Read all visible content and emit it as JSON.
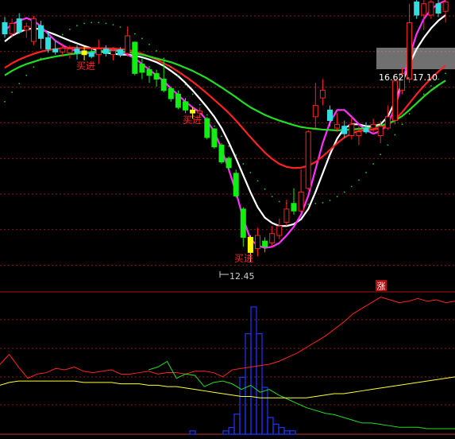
{
  "chart_data": [
    {
      "type": "candlestick",
      "panel": "price",
      "y_axis": "price (unlabeled)",
      "ylim": [
        11.8,
        19.4
      ],
      "candles": [
        {
          "o": 18.8,
          "c": 18.5,
          "h": 18.95,
          "l": 18.4,
          "col": "cyan"
        },
        {
          "o": 18.5,
          "c": 18.78,
          "h": 18.9,
          "l": 18.4,
          "col": "red"
        },
        {
          "o": 18.9,
          "c": 18.55,
          "h": 19.05,
          "l": 18.5,
          "col": "cyan"
        },
        {
          "o": 18.6,
          "c": 18.7,
          "h": 18.8,
          "l": 18.4,
          "col": "red"
        },
        {
          "o": 18.3,
          "c": 18.9,
          "h": 18.98,
          "l": 18.2,
          "col": "red"
        },
        {
          "o": 18.72,
          "c": 18.38,
          "h": 18.85,
          "l": 18.1,
          "col": "cyan"
        },
        {
          "o": 18.4,
          "c": 18.1,
          "h": 18.55,
          "l": 18.0,
          "col": "cyan"
        },
        {
          "o": 18.1,
          "c": 18.02,
          "h": 18.3,
          "l": 17.95,
          "col": "cyan"
        },
        {
          "o": 18.02,
          "c": 18.12,
          "h": 18.25,
          "l": 17.9,
          "col": "red"
        },
        {
          "o": 18.0,
          "c": 18.1,
          "h": 18.2,
          "l": 17.85,
          "col": "red"
        },
        {
          "o": 18.1,
          "c": 18.0,
          "h": 18.2,
          "l": 17.82,
          "col": "cyan"
        },
        {
          "o": 18.05,
          "c": 17.95,
          "h": 18.15,
          "l": 17.8,
          "col": "yellow"
        },
        {
          "o": 18.0,
          "c": 17.9,
          "h": 18.1,
          "l": 17.85,
          "col": "cyan"
        },
        {
          "o": 17.95,
          "c": 18.1,
          "h": 18.35,
          "l": 17.7,
          "col": "red"
        },
        {
          "o": 18.1,
          "c": 17.98,
          "h": 18.2,
          "l": 17.9,
          "col": "cyan"
        },
        {
          "o": 17.95,
          "c": 18.05,
          "h": 18.15,
          "l": 17.8,
          "col": "red"
        },
        {
          "o": 18.08,
          "c": 17.95,
          "h": 18.15,
          "l": 17.88,
          "col": "cyan"
        },
        {
          "o": 17.98,
          "c": 18.45,
          "h": 18.7,
          "l": 17.9,
          "col": "red"
        },
        {
          "o": 18.28,
          "c": 17.45,
          "h": 18.3,
          "l": 17.4,
          "col": "green"
        },
        {
          "o": 17.7,
          "c": 17.48,
          "h": 17.85,
          "l": 17.3,
          "col": "green"
        },
        {
          "o": 17.55,
          "c": 17.4,
          "h": 17.65,
          "l": 17.2,
          "col": "green"
        },
        {
          "o": 17.45,
          "c": 17.3,
          "h": 17.55,
          "l": 17.1,
          "col": "green"
        },
        {
          "o": 17.3,
          "c": 17.0,
          "h": 17.8,
          "l": 16.95,
          "col": "green"
        },
        {
          "o": 17.05,
          "c": 16.78,
          "h": 17.1,
          "l": 16.7,
          "col": "green"
        },
        {
          "o": 16.9,
          "c": 16.55,
          "h": 17.0,
          "l": 16.5,
          "col": "green"
        },
        {
          "o": 16.7,
          "c": 16.48,
          "h": 16.8,
          "l": 16.4,
          "col": "green"
        },
        {
          "o": 16.48,
          "c": 16.4,
          "h": 16.55,
          "l": 16.25,
          "col": "yellow"
        },
        {
          "o": 16.45,
          "c": 16.4,
          "h": 16.55,
          "l": 16.3,
          "col": "red"
        },
        {
          "o": 16.25,
          "c": 15.75,
          "h": 16.3,
          "l": 15.7,
          "col": "green"
        },
        {
          "o": 15.98,
          "c": 15.5,
          "h": 16.0,
          "l": 15.45,
          "col": "green"
        },
        {
          "o": 15.55,
          "c": 15.1,
          "h": 15.6,
          "l": 15.05,
          "col": "green"
        },
        {
          "o": 15.2,
          "c": 14.95,
          "h": 15.25,
          "l": 14.9,
          "col": "green"
        },
        {
          "o": 14.8,
          "c": 14.2,
          "h": 14.9,
          "l": 14.15,
          "col": "green"
        },
        {
          "o": 13.85,
          "c": 13.1,
          "h": 13.9,
          "l": 12.85,
          "col": "green"
        },
        {
          "o": 13.1,
          "c": 12.7,
          "h": 13.15,
          "l": 12.45,
          "col": "yellow"
        },
        {
          "o": 12.8,
          "c": 13.15,
          "h": 13.35,
          "l": 12.6,
          "col": "red"
        },
        {
          "o": 13.0,
          "c": 12.85,
          "h": 13.1,
          "l": 12.7,
          "col": "green"
        },
        {
          "o": 12.95,
          "c": 13.2,
          "h": 13.4,
          "l": 12.85,
          "col": "red"
        },
        {
          "o": 13.15,
          "c": 13.4,
          "h": 13.6,
          "l": 13.05,
          "col": "red"
        },
        {
          "o": 13.5,
          "c": 13.85,
          "h": 14.1,
          "l": 13.4,
          "col": "red"
        },
        {
          "o": 13.8,
          "c": 14.0,
          "h": 14.4,
          "l": 13.7,
          "col": "green"
        },
        {
          "o": 13.8,
          "c": 14.3,
          "h": 14.9,
          "l": 13.75,
          "col": "red"
        },
        {
          "o": 14.4,
          "c": 15.9,
          "h": 15.95,
          "l": 14.35,
          "col": "red"
        },
        {
          "o": 16.3,
          "c": 16.6,
          "h": 17.2,
          "l": 16.0,
          "col": "red"
        },
        {
          "o": 16.8,
          "c": 17.0,
          "h": 17.3,
          "l": 16.6,
          "col": "red"
        },
        {
          "o": 16.48,
          "c": 16.2,
          "h": 16.6,
          "l": 16.05,
          "col": "cyan"
        },
        {
          "o": 16.1,
          "c": 16.0,
          "h": 16.4,
          "l": 15.9,
          "col": "red"
        },
        {
          "o": 16.05,
          "c": 15.85,
          "h": 16.2,
          "l": 15.75,
          "col": "cyan"
        },
        {
          "o": 15.8,
          "c": 16.1,
          "h": 16.3,
          "l": 15.7,
          "col": "red"
        },
        {
          "o": 15.9,
          "c": 15.8,
          "h": 16.05,
          "l": 15.55,
          "col": "red"
        },
        {
          "o": 16.0,
          "c": 15.9,
          "h": 16.15,
          "l": 15.85,
          "col": "cyan"
        },
        {
          "o": 16.0,
          "c": 16.1,
          "h": 16.25,
          "l": 15.85,
          "col": "red"
        },
        {
          "o": 15.8,
          "c": 16.05,
          "h": 16.2,
          "l": 15.6,
          "col": "red"
        },
        {
          "o": 16.0,
          "c": 16.3,
          "h": 16.6,
          "l": 15.95,
          "col": "red"
        },
        {
          "o": 16.2,
          "c": 17.25,
          "h": 17.3,
          "l": 16.1,
          "col": "red"
        },
        {
          "o": 17.0,
          "c": 17.45,
          "h": 17.6,
          "l": 16.9,
          "col": "red"
        },
        {
          "o": 17.3,
          "c": 18.8,
          "h": 19.3,
          "l": 17.2,
          "col": "red"
        },
        {
          "o": 19.35,
          "c": 19.0,
          "h": 19.4,
          "l": 18.9,
          "col": "cyan"
        },
        {
          "o": 19.0,
          "c": 19.3,
          "h": 19.4,
          "l": 18.6,
          "col": "red"
        },
        {
          "o": 19.0,
          "c": 19.35,
          "h": 19.4,
          "l": 18.9,
          "col": "red"
        },
        {
          "o": 19.3,
          "c": 19.05,
          "h": 19.4,
          "l": 18.95,
          "col": "cyan"
        },
        {
          "o": 19.1,
          "c": 19.35,
          "h": 19.4,
          "l": 18.8,
          "col": "red"
        }
      ],
      "series": [
        {
          "name": "",
          "color": "#ffffff",
          "values": [
            18.3,
            18.45,
            18.55,
            18.62,
            18.65,
            18.62,
            18.55,
            18.48,
            18.4,
            18.32,
            18.25,
            18.18,
            18.12,
            18.05,
            18.0,
            17.98,
            17.95,
            17.95,
            17.92,
            17.88,
            17.82,
            17.75,
            17.65,
            17.52,
            17.38,
            17.2,
            17.0,
            16.78,
            16.55,
            16.3,
            16.0,
            15.62,
            15.2,
            14.75,
            14.3,
            13.9,
            13.62,
            13.48,
            13.4,
            13.4,
            13.45,
            13.58,
            13.85,
            14.3,
            14.8,
            15.3,
            15.72,
            16.0,
            16.1,
            16.1,
            16.05,
            16.05,
            16.1,
            16.3,
            16.7,
            17.2,
            17.7,
            18.1,
            18.4,
            18.65,
            18.85,
            19.0
          ]
        },
        {
          "name": "",
          "color": "#ff33ff",
          "values": [
            18.6,
            18.75,
            18.85,
            18.92,
            18.85,
            18.7,
            18.5,
            18.32,
            18.2,
            18.1,
            18.05,
            18.0,
            17.98,
            18.02,
            18.08,
            18.1,
            18.05,
            17.95,
            17.85,
            17.7,
            17.55,
            17.4,
            17.25,
            17.05,
            16.88,
            16.7,
            16.55,
            16.42,
            16.2,
            15.9,
            15.45,
            14.9,
            14.3,
            13.6,
            13.05,
            12.88,
            12.82,
            12.85,
            12.95,
            13.15,
            13.38,
            13.7,
            14.2,
            14.9,
            15.6,
            16.15,
            16.48,
            16.48,
            16.3,
            16.1,
            15.95,
            15.85,
            15.92,
            16.1,
            16.55,
            17.2,
            17.9,
            18.5,
            18.9,
            19.15,
            19.3,
            19.38
          ]
        },
        {
          "name": "",
          "color": "#ff2222",
          "values": [
            17.6,
            17.72,
            17.82,
            17.9,
            17.97,
            18.03,
            18.07,
            18.1,
            18.12,
            18.13,
            18.13,
            18.12,
            18.12,
            18.12,
            18.12,
            18.11,
            18.1,
            18.08,
            18.03,
            17.97,
            17.9,
            17.82,
            17.72,
            17.62,
            17.5,
            17.37,
            17.23,
            17.08,
            16.92,
            16.75,
            16.58,
            16.4,
            16.2,
            15.98,
            15.76,
            15.55,
            15.35,
            15.18,
            15.05,
            14.97,
            14.94,
            14.95,
            15.0,
            15.1,
            15.25,
            15.42,
            15.6,
            15.75,
            15.86,
            15.92,
            15.95,
            15.96,
            16.0,
            16.08,
            16.22,
            16.42,
            16.66,
            16.9,
            17.12,
            17.32,
            17.5,
            17.66
          ]
        },
        {
          "name": "",
          "color": "#22dd22",
          "values": [
            17.4,
            17.52,
            17.62,
            17.7,
            17.76,
            17.82,
            17.86,
            17.9,
            17.93,
            17.96,
            17.98,
            18.0,
            18.02,
            18.04,
            18.05,
            18.05,
            18.04,
            18.02,
            17.98,
            17.95,
            17.9,
            17.85,
            17.8,
            17.75,
            17.68,
            17.6,
            17.52,
            17.42,
            17.32,
            17.2,
            17.08,
            16.95,
            16.82,
            16.68,
            16.55,
            16.45,
            16.35,
            16.27,
            16.2,
            16.14,
            16.08,
            16.03,
            16.0,
            15.98,
            15.96,
            15.95,
            15.94,
            15.95,
            15.96,
            15.98,
            16.0,
            16.02,
            16.06,
            16.12,
            16.2,
            16.32,
            16.48,
            16.66,
            16.84,
            17.0,
            17.14,
            17.26
          ]
        },
        {
          "name": "",
          "color": "#22cc22",
          "style": "dotted",
          "values": [
            16.7,
            16.95,
            17.18,
            17.4,
            17.62,
            17.85,
            18.1,
            18.3,
            18.48,
            18.62,
            18.72,
            18.78,
            18.8,
            18.8,
            18.78,
            18.74,
            18.68,
            18.6,
            18.5,
            18.38,
            18.22,
            18.05,
            17.85,
            17.62,
            17.4,
            17.15,
            16.9,
            16.62,
            16.35,
            16.05,
            15.78,
            15.52,
            15.28,
            15.05,
            14.82,
            14.6,
            14.38,
            14.18,
            14.05,
            14.0,
            13.98,
            13.98,
            13.98,
            14.0,
            14.02,
            14.08,
            14.18,
            14.3,
            14.45,
            14.62,
            14.82,
            15.05,
            15.3,
            15.55,
            15.82,
            16.1,
            16.38,
            16.65,
            16.9,
            17.12,
            17.3,
            17.45
          ]
        }
      ],
      "annotations": [
        {
          "text": "买进",
          "color": "#ff2222"
        },
        {
          "text": "买进",
          "color": "#ff2222"
        },
        {
          "text": "买进",
          "color": "#ff2222"
        },
        {
          "text": "12.45",
          "color": "#cccccc"
        },
        {
          "text": "16.62 - 17.10",
          "color": "#ffffff"
        },
        {
          "text": "涨",
          "color": "#ffffff"
        }
      ]
    },
    {
      "type": "bar+line",
      "panel": "indicator",
      "bars": {
        "color": "#2233ff",
        "values": [
          0,
          1,
          0,
          0,
          0,
          0,
          0,
          1,
          2,
          6,
          17,
          30,
          38,
          30,
          14,
          5,
          3,
          2,
          1,
          1,
          0,
          0
        ]
      },
      "series": [
        {
          "name": "",
          "color": "#ff2222",
          "values": [
            50,
            57,
            48,
            40,
            43,
            44,
            47,
            46,
            48,
            45,
            44,
            45,
            46,
            43,
            43,
            44,
            45,
            43,
            44,
            44,
            43,
            45,
            45,
            44,
            41,
            46,
            47,
            48,
            49,
            50,
            52,
            55,
            58,
            62,
            66,
            70,
            75,
            80,
            86,
            90,
            94,
            98,
            96,
            94,
            95,
            97,
            95,
            96,
            94,
            95
          ]
        },
        {
          "name": "",
          "color": "#22dd22",
          "values": [
            null,
            null,
            null,
            null,
            null,
            null,
            null,
            null,
            null,
            null,
            null,
            null,
            null,
            null,
            null,
            null,
            46,
            48,
            52,
            40,
            43,
            42,
            34,
            37,
            38,
            36,
            32,
            35,
            30,
            32,
            28,
            25,
            22,
            19,
            17,
            15,
            14,
            12,
            10,
            8,
            8,
            7,
            6,
            5,
            5,
            5,
            4,
            4,
            4,
            4
          ]
        },
        {
          "name": "",
          "color": "#ffff33",
          "values": [
            35,
            37,
            38,
            38,
            38,
            38,
            38,
            38,
            38,
            37,
            37,
            37,
            37,
            36,
            36,
            36,
            35,
            35,
            34,
            34,
            33,
            32,
            31,
            30,
            29,
            28,
            27,
            27,
            26,
            26,
            26,
            26,
            26,
            26,
            27,
            28,
            29,
            29,
            30,
            31,
            32,
            33,
            34,
            35,
            36,
            37,
            38,
            39,
            40,
            41
          ]
        }
      ]
    }
  ]
}
